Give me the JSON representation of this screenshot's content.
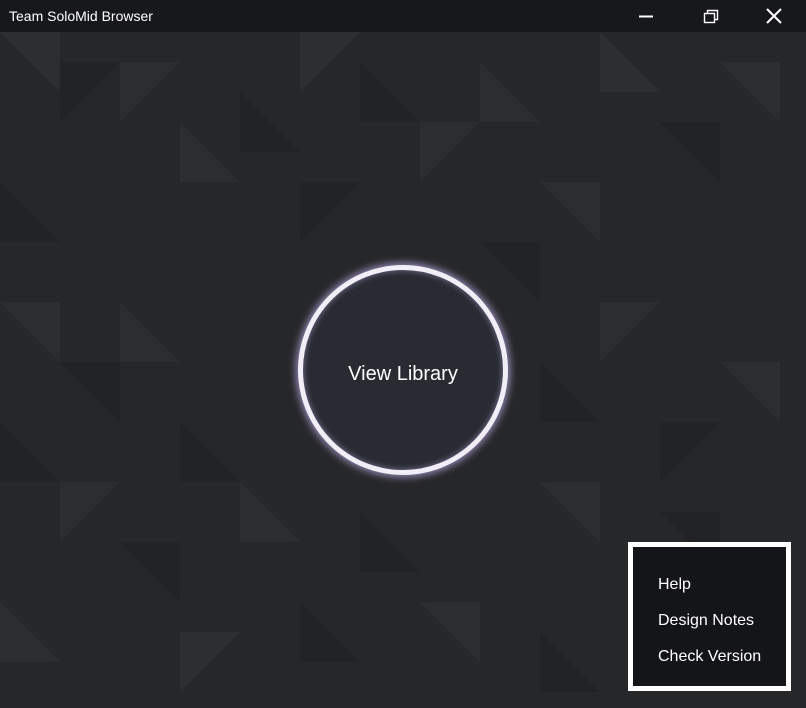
{
  "window": {
    "title": "Team SoloMid Browser",
    "controls": {
      "minimize_icon": "minimize-icon",
      "restore_icon": "restore-icon",
      "close_icon": "close-icon"
    }
  },
  "main": {
    "library_button_label": "View Library"
  },
  "menu": {
    "items": [
      {
        "label": "Help"
      },
      {
        "label": "Design Notes"
      },
      {
        "label": "Check Version"
      }
    ]
  },
  "colors": {
    "titlebar": "#17181b",
    "background": "#262729",
    "ring": "#f1eef8",
    "ring_glow": "#bfb0eb",
    "menu_background": "#141518",
    "menu_border": "#ffffff"
  }
}
